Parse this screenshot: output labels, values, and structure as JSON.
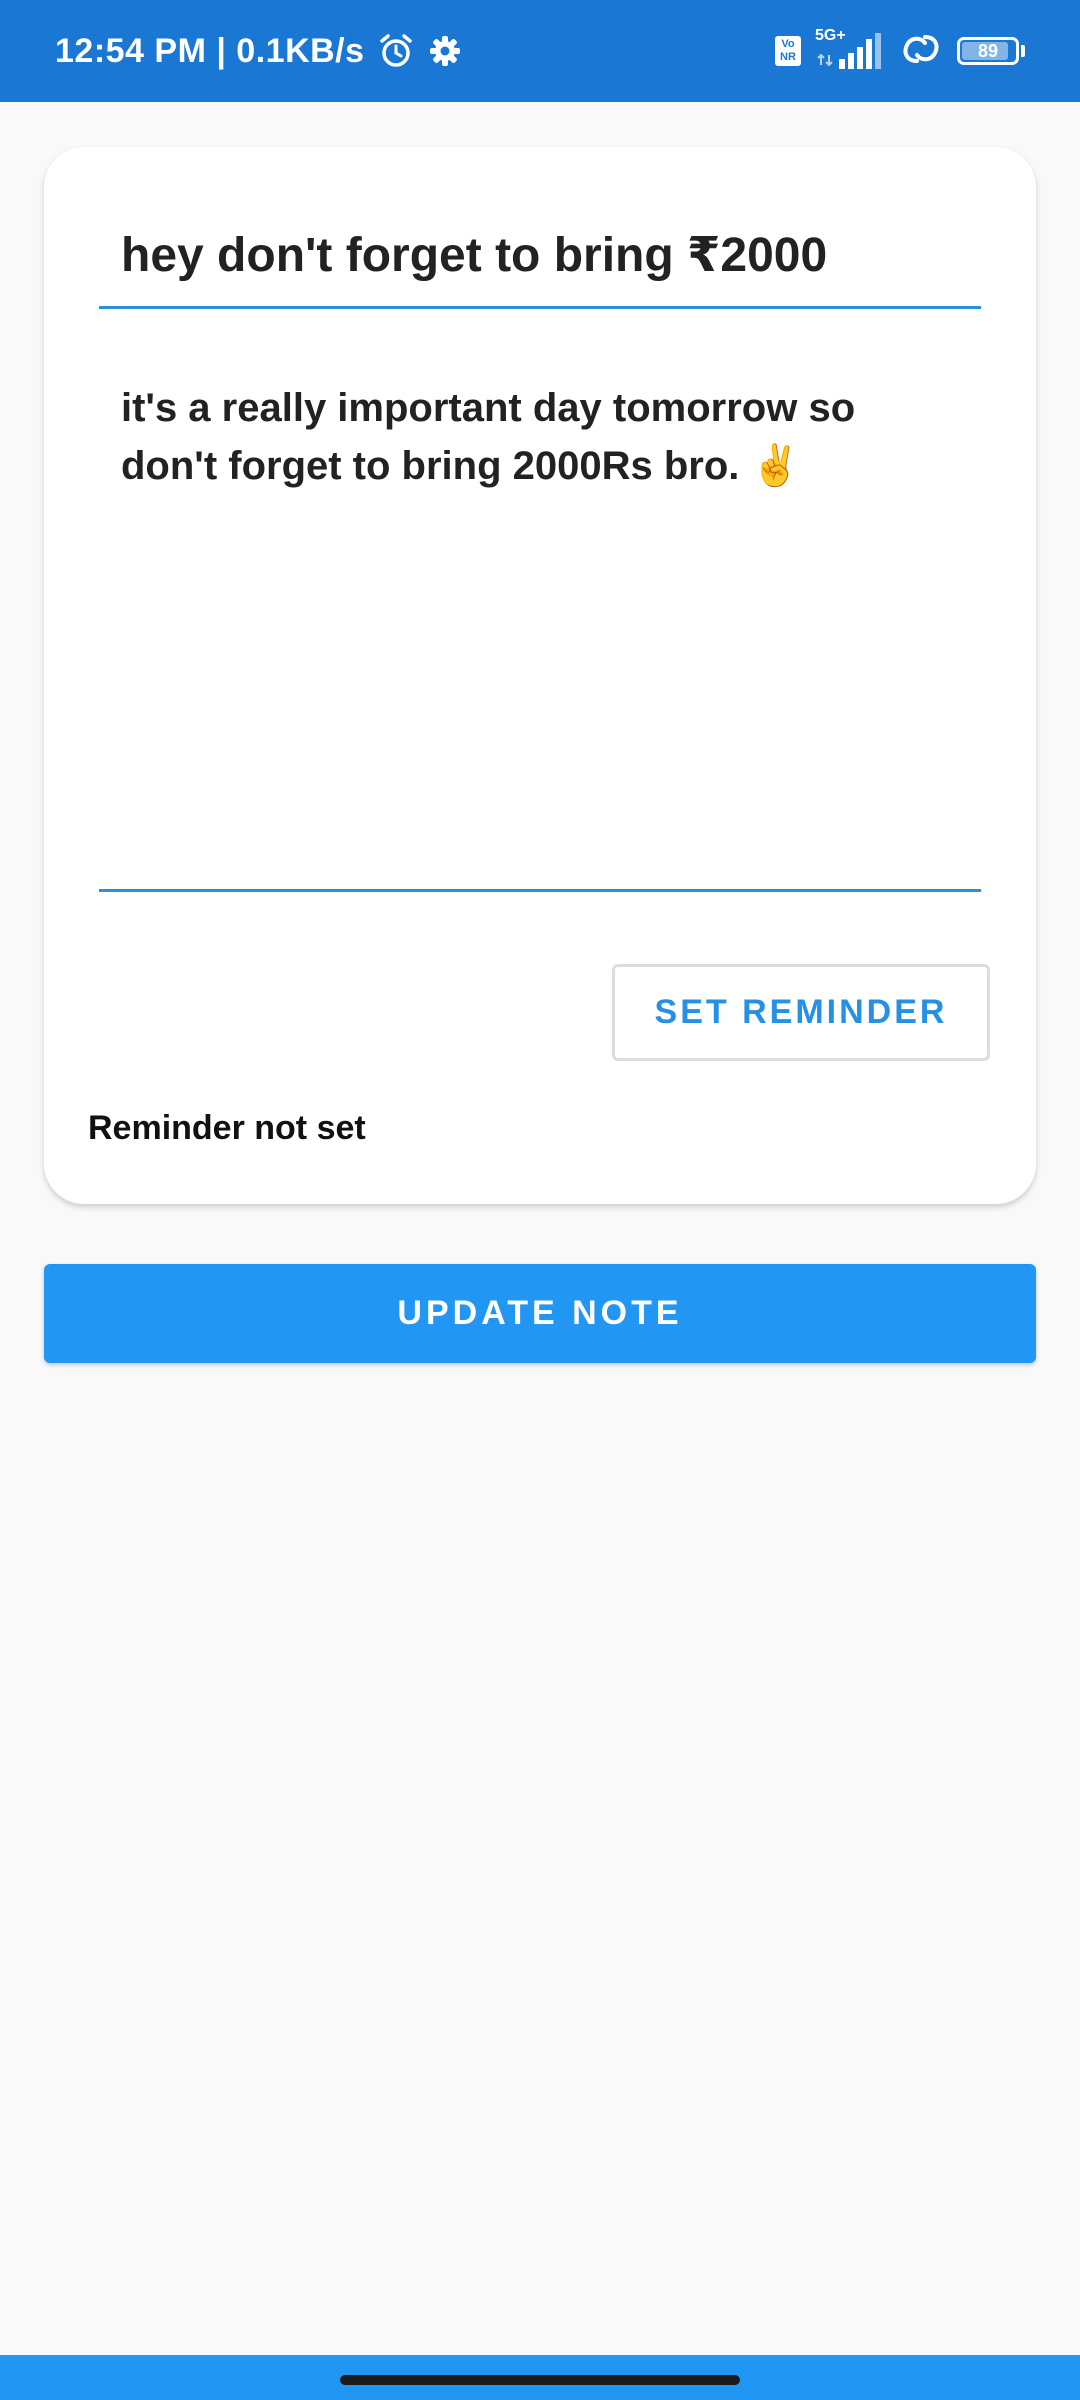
{
  "status_bar": {
    "time_speed": "12:54 PM | 0.1KB/s",
    "volte": "Vo NR",
    "network_label": "5G+",
    "battery": "89",
    "battery_level": 0.89,
    "icons": [
      "alarm-icon",
      "gear-icon",
      "signal-icon",
      "hotspot-icon",
      "battery-icon"
    ]
  },
  "note": {
    "title": "hey don't forget to bring ₹2000",
    "body": "it's a really important day tomorrow so don't forget to bring 2000Rs bro. ✌️"
  },
  "reminder": {
    "button_label": "SET REMINDER",
    "status": "Reminder not set"
  },
  "actions": {
    "update_label": "UPDATE NOTE"
  },
  "colors": {
    "status_bar": "#1a78d4",
    "accent": "#2196f3",
    "field_underline": "#2b8fd9",
    "background": "#f9f9f9"
  }
}
